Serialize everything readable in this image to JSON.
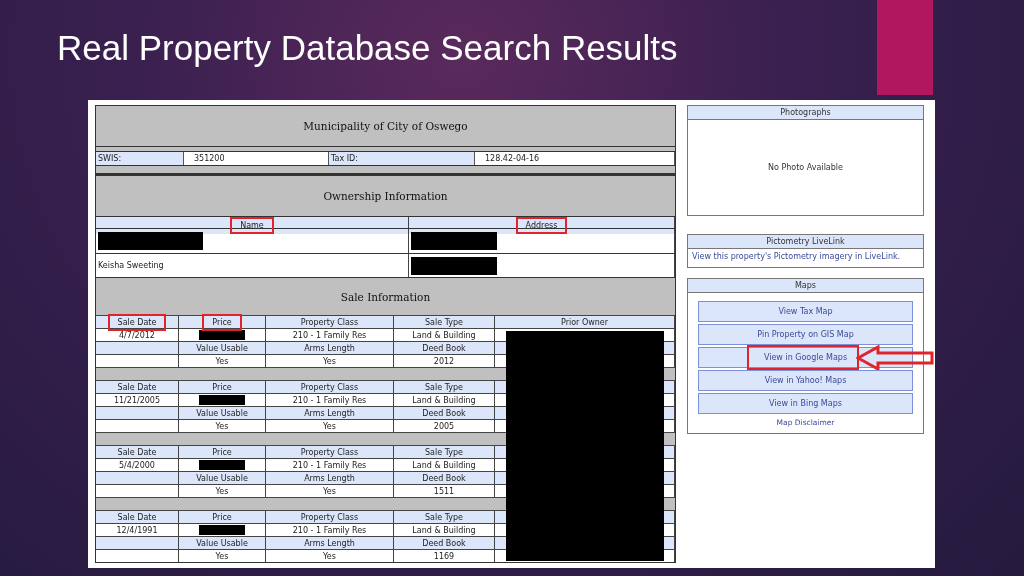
{
  "slide": {
    "title": "Real Property Database Search Results"
  },
  "municipality": {
    "title": "Municipality of City of Oswego"
  },
  "identifiers": [
    {
      "label": "SWIS:",
      "value": "351200"
    },
    {
      "label": "Tax ID:",
      "value": "128.42-04-16"
    }
  ],
  "ownership": {
    "title": "Ownership Information",
    "columns": [
      {
        "label": "Name",
        "highlighted": true
      },
      {
        "label": "Address",
        "highlighted": true
      }
    ],
    "owners": [
      {
        "name_redacted": true,
        "address_redacted": true
      },
      {
        "name": "Keisha Sweeting",
        "address_redacted": true
      }
    ]
  },
  "sales": {
    "title": "Sale Information",
    "prior_owner_redacted": true,
    "records": [
      {
        "headers": [
          {
            "label": "Sale Date",
            "highlighted": true
          },
          {
            "label": "Price",
            "highlighted": true
          },
          {
            "label": "Property Class",
            "highlighted": false
          },
          {
            "label": "Sale Type",
            "highlighted": false
          },
          {
            "label": "Prior Owner",
            "highlighted": false
          }
        ],
        "sale_date": "4/7/2012",
        "price_redacted": true,
        "property_class": "210 - 1 Family Res",
        "sale_type": "Land & Building",
        "subheaders": [
          "Value Usable",
          "Arms Length",
          "Deed Book"
        ],
        "value_usable": "Yes",
        "arms_length": "Yes",
        "deed_book": "2012"
      },
      {
        "headers": [
          {
            "label": "Sale Date",
            "highlighted": false
          },
          {
            "label": "Price",
            "highlighted": false
          },
          {
            "label": "Property Class",
            "highlighted": false
          },
          {
            "label": "Sale Type",
            "highlighted": false
          }
        ],
        "sale_date": "11/21/2005",
        "price_redacted": true,
        "property_class": "210 - 1 Family Res",
        "sale_type": "Land & Building",
        "subheaders": [
          "Value Usable",
          "Arms Length",
          "Deed Book"
        ],
        "value_usable": "Yes",
        "arms_length": "Yes",
        "deed_book": "2005"
      },
      {
        "headers": [
          {
            "label": "Sale Date",
            "highlighted": false
          },
          {
            "label": "Price",
            "highlighted": false
          },
          {
            "label": "Property Class",
            "highlighted": false
          },
          {
            "label": "Sale Type",
            "highlighted": false
          }
        ],
        "sale_date": "5/4/2000",
        "price_redacted": true,
        "property_class": "210 - 1 Family Res",
        "sale_type": "Land & Building",
        "subheaders": [
          "Value Usable",
          "Arms Length",
          "Deed Book"
        ],
        "value_usable": "Yes",
        "arms_length": "Yes",
        "deed_book": "1511"
      },
      {
        "headers": [
          {
            "label": "Sale Date",
            "highlighted": false
          },
          {
            "label": "Price",
            "highlighted": false
          },
          {
            "label": "Property Class",
            "highlighted": false
          },
          {
            "label": "Sale Type",
            "highlighted": false
          }
        ],
        "sale_date": "12/4/1991",
        "price_redacted": true,
        "property_class": "210 - 1 Family Res",
        "sale_type": "Land & Building",
        "subheaders": [
          "Value Usable",
          "Arms Length",
          "Deed Book"
        ],
        "value_usable": "Yes",
        "arms_length": "Yes",
        "deed_book": "1169"
      }
    ]
  },
  "photographs": {
    "title": "Photographs",
    "message": "No Photo Available"
  },
  "livelink": {
    "title": "Pictometry LiveLink",
    "link": "View this property's Pictometry imagery in LiveLink."
  },
  "maps": {
    "title": "Maps",
    "buttons": [
      {
        "label": "View Tax Map",
        "highlighted": false
      },
      {
        "label": "Pin Property on GIS Map",
        "highlighted": false
      },
      {
        "label": "View in Google Maps",
        "highlighted": true
      },
      {
        "label": "View in Yahoo! Maps",
        "highlighted": false
      },
      {
        "label": "View in Bing Maps",
        "highlighted": false
      }
    ],
    "disclaimer": "Map Disclaimer"
  }
}
